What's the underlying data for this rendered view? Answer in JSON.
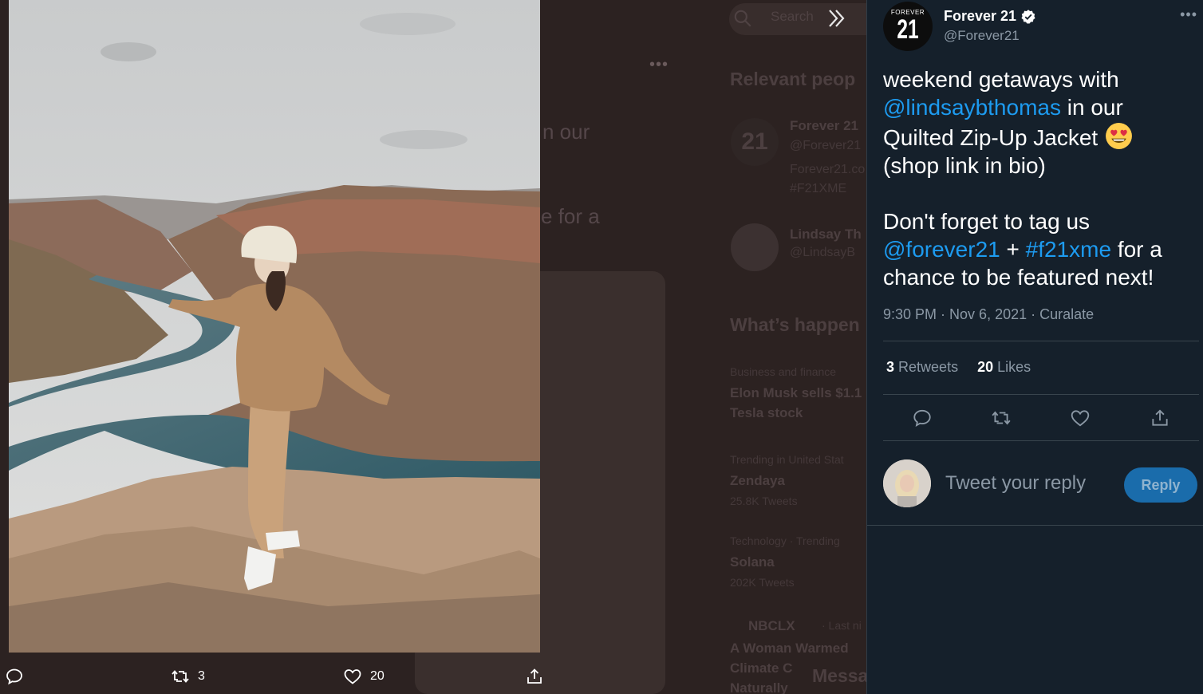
{
  "background": {
    "fragments": [
      "n our",
      "e for a"
    ],
    "search_placeholder": "Search",
    "sidebar": {
      "relevant_heading": "Relevant peop",
      "people": [
        {
          "name": "Forever 21",
          "handle": "@Forever21",
          "bio1": "Forever21.co",
          "bio2": "#F21XME",
          "avatar_text": "21"
        },
        {
          "name": "Lindsay Th",
          "handle": "@LindsayB"
        }
      ],
      "happening_heading": "What’s happen",
      "trends": [
        {
          "context": "Business and finance",
          "title1": "Elon Musk sells $1.1",
          "title2": "Tesla stock"
        },
        {
          "context": "Trending in United Stat",
          "title1": "Zendaya",
          "sub": "25.8K Tweets"
        },
        {
          "context": "Technology · Trending",
          "title1": "Solana",
          "sub": "202K Tweets"
        }
      ],
      "news": {
        "source": "NBCLX",
        "time": "· Last ni",
        "line1": "A Woman Warmed",
        "line2": "Climate C",
        "line3": "Naturally"
      },
      "messages": "Messa"
    }
  },
  "media_bar": {
    "retweets": "3",
    "likes": "20"
  },
  "tweet": {
    "author_name": "Forever 21",
    "author_handle": "@Forever21",
    "avatar_small": "FOREVER",
    "avatar_big": "21",
    "text_line1": "weekend getaways with ",
    "mention1": "@lindsaybthomas",
    "text_line2": " in our Quilted Zip-Up Jacket ",
    "text_line3": "(shop link in bio)",
    "text_line4": "Don't forget to tag us ",
    "mention2": "@forever21",
    "plus": " + ",
    "hashtag": "#f21xme",
    "text_line5": " for a chance to be featured next!",
    "time": "9:30 PM",
    "sep": " · ",
    "date": "Nov 6, 2021",
    "source": "Curalate",
    "retweet_count": "3",
    "retweet_label": "Retweets",
    "like_count": "20",
    "like_label": "Likes"
  },
  "reply": {
    "placeholder": "Tweet your reply",
    "button": "Reply"
  },
  "colors": {
    "panel_bg": "#15202b",
    "link": "#1d9bf0",
    "muted": "#8b98a5",
    "reply_button": "#1a6cab"
  },
  "icons": [
    "search-icon",
    "chevron-double-right-icon",
    "verified-badge-icon",
    "more-icon",
    "reply-icon",
    "retweet-icon",
    "like-icon",
    "share-icon",
    "heart-eyes-emoji"
  ]
}
